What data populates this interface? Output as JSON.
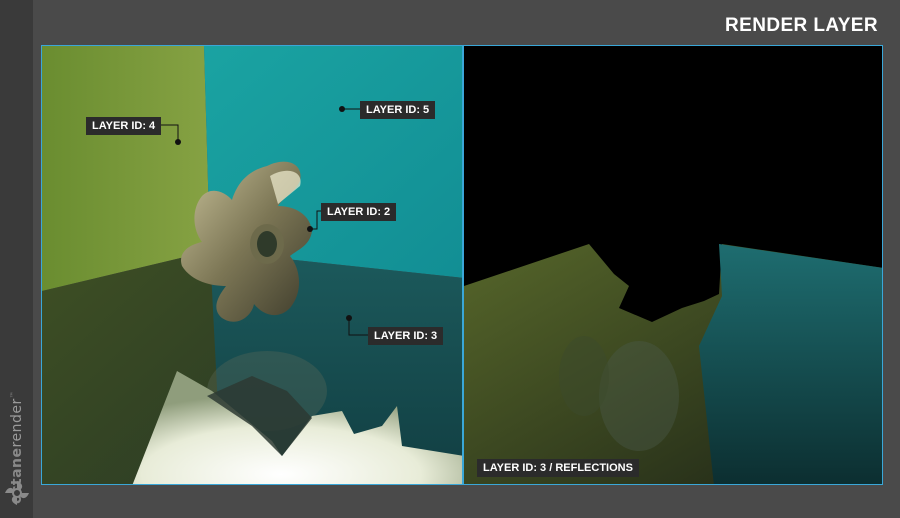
{
  "header": {
    "title": "RENDER LAYER"
  },
  "brand": {
    "name_bold": "octane",
    "name_light": "render",
    "trademark": "™"
  },
  "left_panel": {
    "labels": {
      "layer4": "LAYER ID: 4",
      "layer5": "LAYER ID: 5",
      "layer2": "LAYER ID: 2",
      "layer3": "LAYER ID: 3"
    }
  },
  "right_panel": {
    "caption": "LAYER ID: 3 / REFLECTIONS"
  },
  "colors": {
    "accent_border": "#3aa7d8",
    "label_bg": "#2b2b2b",
    "wall_green": "#7d9b3c",
    "wall_teal": "#1aa3a6"
  }
}
